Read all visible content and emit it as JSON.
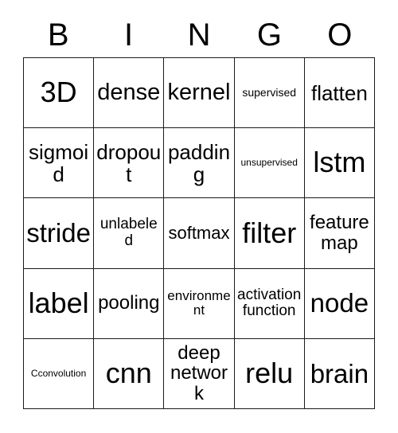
{
  "card": {
    "title": "BINGO",
    "header_letters": [
      "B",
      "I",
      "N",
      "G",
      "O"
    ],
    "columns": 5,
    "rows": 5,
    "border_color": "#1a1a1a",
    "background_color": "#ffffff",
    "text_color": "#000000",
    "cells": [
      [
        {
          "text": "3D",
          "size": "fs-3xl"
        },
        {
          "text": "dense",
          "size": "fs-xl"
        },
        {
          "text": "kernel",
          "size": "fs-xl"
        },
        {
          "text": "supervised",
          "size": "fs-xs"
        },
        {
          "text": "flatten",
          "size": "fs-l"
        }
      ],
      [
        {
          "text": "sigmoid",
          "size": "fs-l"
        },
        {
          "text": "dropout",
          "size": "fs-l"
        },
        {
          "text": "padding",
          "size": "fs-l"
        },
        {
          "text": "unsupervised",
          "size": "fs-xxs"
        },
        {
          "text": "lstm",
          "size": "fs-3xl"
        }
      ],
      [
        {
          "text": "stride",
          "size": "fs-xxl"
        },
        {
          "text": "unlabeled",
          "size": "fs-sm"
        },
        {
          "text": "softmax",
          "size": "fs-m"
        },
        {
          "text": "filter",
          "size": "fs-3xl"
        },
        {
          "text": "feature map",
          "size": "fs-ml"
        }
      ],
      [
        {
          "text": "label",
          "size": "fs-3xl"
        },
        {
          "text": "pooling",
          "size": "fs-ml"
        },
        {
          "text": "environment",
          "size": "fs-s"
        },
        {
          "text": "activation function",
          "size": "fs-sm"
        },
        {
          "text": "node",
          "size": "fs-xxl"
        }
      ],
      [
        {
          "text": "Cconvolution",
          "size": "fs-xxs"
        },
        {
          "text": "cnn",
          "size": "fs-3xl"
        },
        {
          "text": "deep network",
          "size": "fs-ml"
        },
        {
          "text": "relu",
          "size": "fs-3xl"
        },
        {
          "text": "brain",
          "size": "fs-xxl"
        }
      ]
    ]
  }
}
